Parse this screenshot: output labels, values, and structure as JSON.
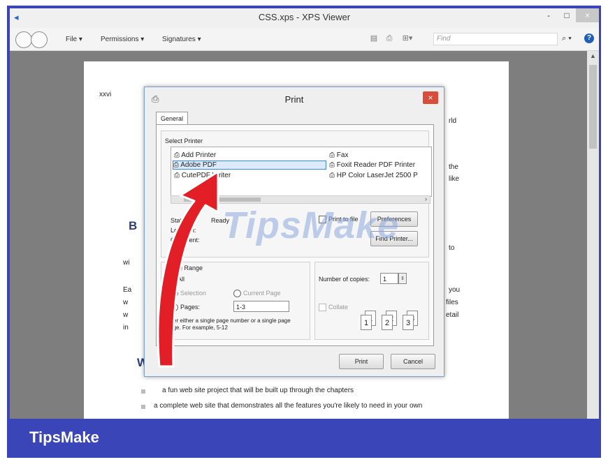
{
  "window": {
    "title": "CSS.xps - XPS Viewer",
    "minimize": "-",
    "maximize": "□",
    "close": "×"
  },
  "toolbar": {
    "menus": [
      "File ▾",
      "Permissions ▾",
      "Signatures ▾"
    ],
    "find_placeholder": "Find",
    "search_glyph": "⌕ ▾",
    "help": "?"
  },
  "document": {
    "page_number": "xxvi",
    "fragments": [
      "rld",
      "the",
      "like",
      "to",
      "you",
      "files",
      "etail",
      "B",
      "wi",
      "Ea",
      "w",
      "w",
      "in",
      "W"
    ],
    "bullet_1": "a fun web site project that will be built up through the chapters",
    "bullet_2": "a complete web site that demonstrates all the features you're likely to need in your own"
  },
  "dialog": {
    "title": "Print",
    "close": "×",
    "tab": "General",
    "select_printer_label": "Select Printer",
    "printers_left": [
      "Add Printer",
      "Adobe PDF",
      "CutePDF Writer"
    ],
    "printers_right": [
      "Fax",
      "Foxit Reader PDF Printer",
      "HP Color LaserJet 2500 P"
    ],
    "status_label": "Status:",
    "status_value": "Ready",
    "location_label": "Location:",
    "comment_label": "Comment:",
    "print_to_file": "Print to file",
    "preferences": "Preferences",
    "find_printer": "Find Printer...",
    "page_range_label": "Page Range",
    "all": "All",
    "selection": "Selection",
    "current_page": "Current Page",
    "pages": "Pages:",
    "pages_value": "1-3",
    "hint": "Enter either a single page number or a single page range.  For example, 5-12",
    "copies_label": "Number of copies:",
    "copies_value": "1",
    "collate": "Collate",
    "print_button": "Print",
    "cancel_button": "Cancel"
  },
  "watermark": "TipsMake",
  "footer": {
    "brand": "TipsMake"
  },
  "colors": {
    "brand_blue": "#3a45b8",
    "arrow_red": "#e21f26",
    "close_red": "#d84c3c",
    "selection_blue": "#dcebfb"
  }
}
